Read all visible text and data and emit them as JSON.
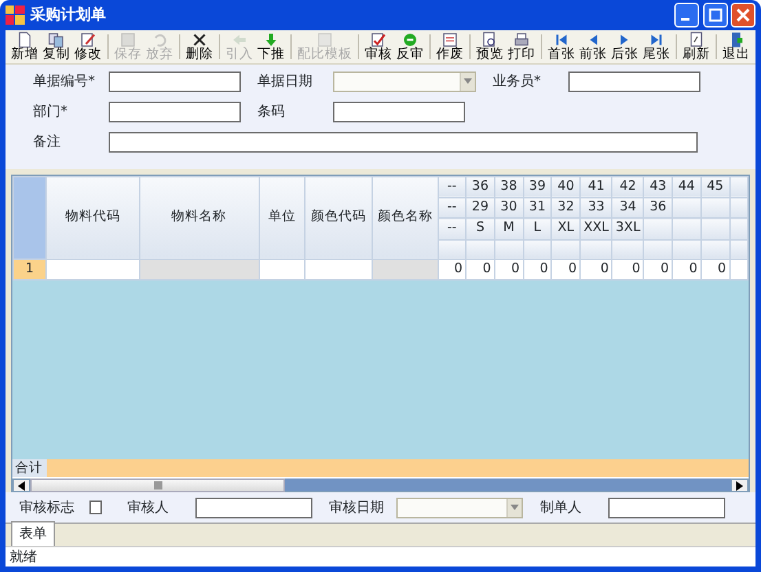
{
  "window": {
    "title": "采购计划单"
  },
  "toolbar": [
    [
      {
        "label": "新增",
        "kind": "new",
        "disabled": false
      },
      {
        "label": "复制",
        "kind": "copy",
        "disabled": false
      },
      {
        "label": "修改",
        "kind": "edit",
        "disabled": false
      }
    ],
    [
      {
        "label": "保存",
        "kind": "save",
        "disabled": true
      },
      {
        "label": "放弃",
        "kind": "undo",
        "disabled": true
      }
    ],
    [
      {
        "label": "删除",
        "kind": "delete",
        "disabled": false
      }
    ],
    [
      {
        "label": "引入",
        "kind": "import",
        "disabled": true
      },
      {
        "label": "下推",
        "kind": "push",
        "disabled": false
      }
    ],
    [
      {
        "label": "配比模板",
        "kind": "template",
        "disabled": true
      }
    ],
    [
      {
        "label": "审核",
        "kind": "approve",
        "disabled": false
      },
      {
        "label": "反审",
        "kind": "unapprove",
        "disabled": false
      }
    ],
    [
      {
        "label": "作废",
        "kind": "void",
        "disabled": false
      }
    ],
    [
      {
        "label": "预览",
        "kind": "preview",
        "disabled": false
      },
      {
        "label": "打印",
        "kind": "print",
        "disabled": false
      }
    ],
    [
      {
        "label": "首张",
        "kind": "first",
        "disabled": false
      },
      {
        "label": "前张",
        "kind": "prev",
        "disabled": false
      },
      {
        "label": "后张",
        "kind": "next",
        "disabled": false
      },
      {
        "label": "尾张",
        "kind": "last",
        "disabled": false
      }
    ],
    [
      {
        "label": "刷新",
        "kind": "refresh",
        "disabled": false
      }
    ],
    [
      {
        "label": "退出",
        "kind": "exit",
        "disabled": false
      }
    ]
  ],
  "form": [
    [
      {
        "label": "单据编号*",
        "kind": "text"
      },
      {
        "label": "单据日期",
        "kind": "date"
      },
      {
        "label": "业务员*",
        "kind": "text"
      }
    ],
    [
      {
        "label": "部门*",
        "kind": "text"
      },
      {
        "label": "条码",
        "kind": "text"
      }
    ],
    [
      {
        "label": "备注",
        "kind": "wide"
      }
    ]
  ],
  "grid": {
    "columns": [
      {
        "label": "物料代码",
        "readonly": false
      },
      {
        "label": "物料名称",
        "readonly": true
      },
      {
        "label": "单位",
        "readonly": false
      },
      {
        "label": "颜色代码",
        "readonly": false
      },
      {
        "label": "颜色名称",
        "readonly": true
      }
    ],
    "size_columns": [
      [
        "--",
        "--",
        "--"
      ],
      [
        "36",
        "29",
        "S"
      ],
      [
        "38",
        "30",
        "M"
      ],
      [
        "39",
        "31",
        "L"
      ],
      [
        "40",
        "32",
        "XL"
      ],
      [
        "41",
        "33",
        "XXL"
      ],
      [
        "42",
        "34",
        "3XL"
      ],
      [
        "43",
        "36"
      ],
      [
        "44"
      ],
      [
        "45"
      ]
    ],
    "rows": [
      {
        "number": "1",
        "sizes": [
          "0",
          "0",
          "0",
          "0",
          "0",
          "0",
          "0",
          "0",
          "0",
          "0"
        ]
      }
    ],
    "total_label": "合计"
  },
  "footer": [
    {
      "label": "审核标志",
      "kind": "checkbox",
      "checked": false
    },
    {
      "label": "审核人",
      "kind": "text"
    },
    {
      "label": "审核日期",
      "kind": "date"
    },
    {
      "label": "制单人",
      "kind": "text"
    }
  ],
  "tabs": [
    {
      "label": "表单",
      "selected": true
    }
  ],
  "status_bar": "就绪"
}
